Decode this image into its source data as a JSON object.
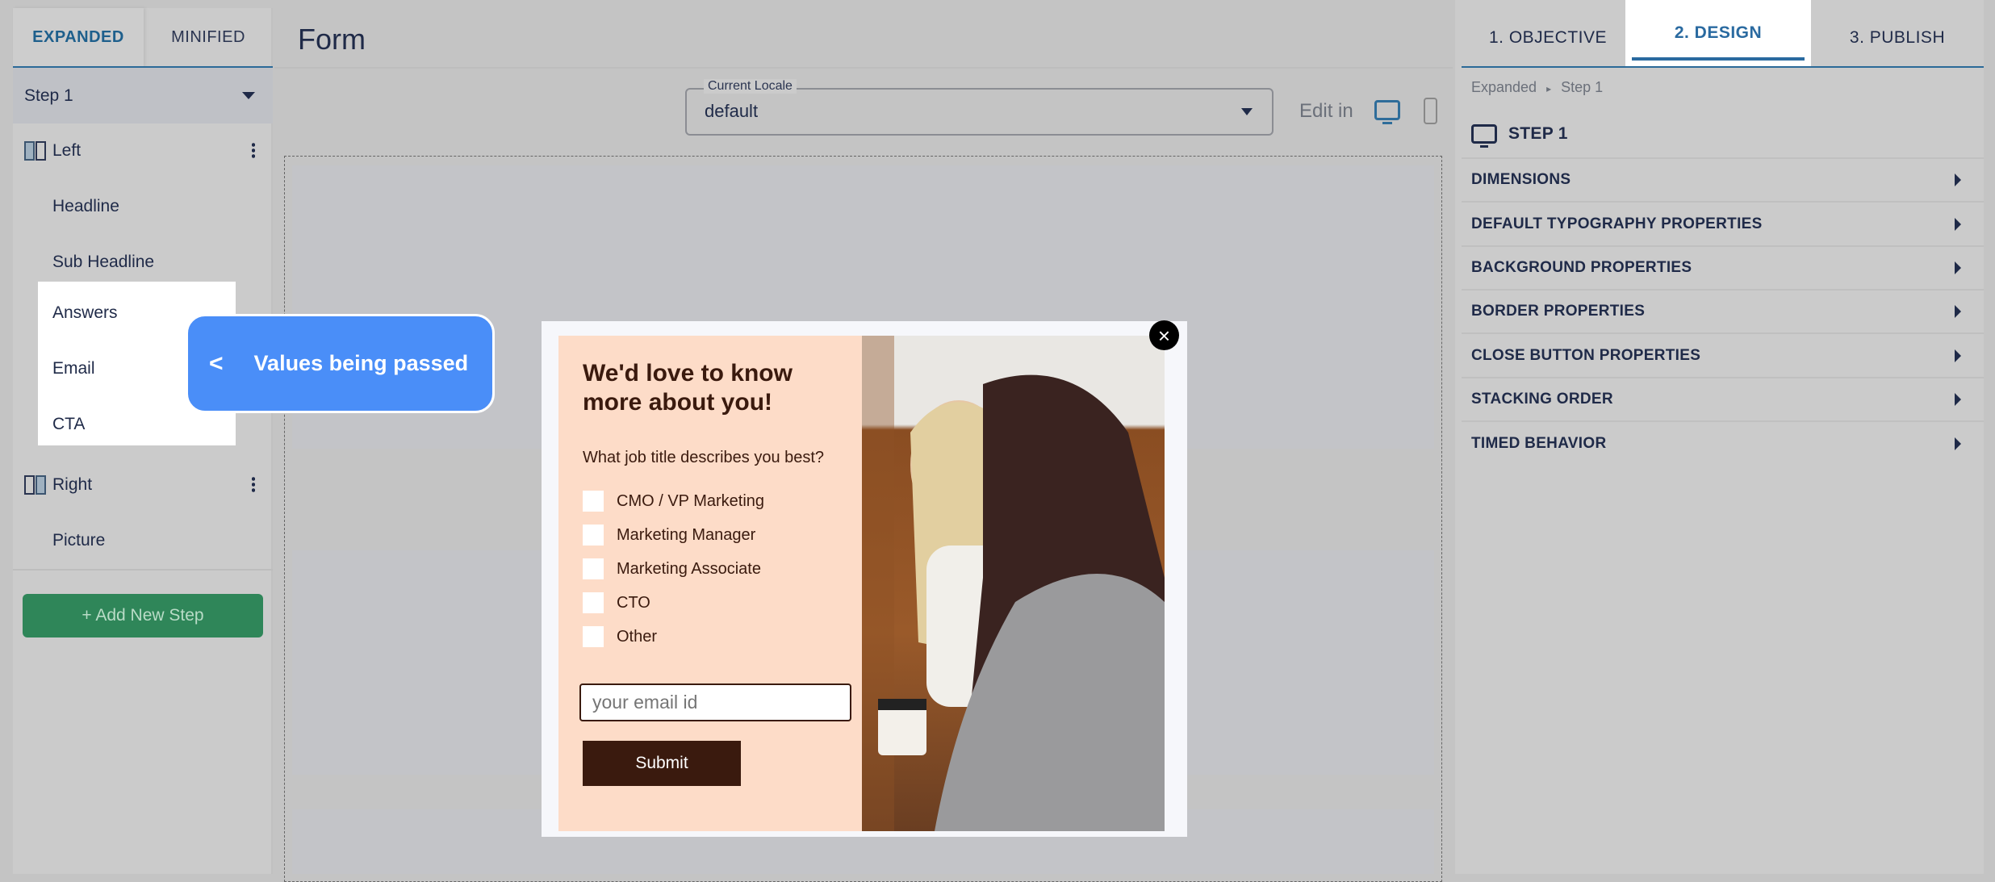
{
  "left_panel": {
    "tabs": [
      "EXPANDED",
      "MINIFIED"
    ],
    "step_select": "Step 1",
    "groups": [
      {
        "label": "Left",
        "items": [
          "Headline",
          "Sub Headline",
          "Answers",
          "Email",
          "CTA"
        ]
      },
      {
        "label": "Right",
        "items": [
          "Picture"
        ]
      }
    ],
    "add_step": "+ Add New Step"
  },
  "header": {
    "title": "Form"
  },
  "locale": {
    "label": "Current Locale",
    "value": "default"
  },
  "edit_in": "Edit in",
  "tooltip": {
    "arrow": "<",
    "text": "Values being passed"
  },
  "popup": {
    "headline": "We'd love to know more about you!",
    "question": "What job title describes you best?",
    "options": [
      "CMO / VP Marketing",
      "Marketing Manager",
      "Marketing Associate",
      "CTO",
      "Other"
    ],
    "email_placeholder": "your email id",
    "submit": "Submit",
    "close": "×"
  },
  "right_panel": {
    "tabs": [
      "1. OBJECTIVE",
      "2. DESIGN",
      "3. PUBLISH"
    ],
    "active_tab": "2. DESIGN",
    "breadcrumb": [
      "Expanded",
      "Step 1"
    ],
    "step_title": "STEP 1",
    "sections": [
      "DIMENSIONS",
      "DEFAULT TYPOGRAPHY PROPERTIES",
      "BACKGROUND PROPERTIES",
      "BORDER PROPERTIES",
      "CLOSE BUTTON PROPERTIES",
      "STACKING ORDER",
      "TIMED BEHAVIOR"
    ]
  },
  "colors": {
    "accent": "#2a6aa0",
    "add_button": "#2f8659",
    "tooltip": "#4a8ef8",
    "popup_panel": "#fddcc8",
    "submit": "#3a1a0e"
  }
}
